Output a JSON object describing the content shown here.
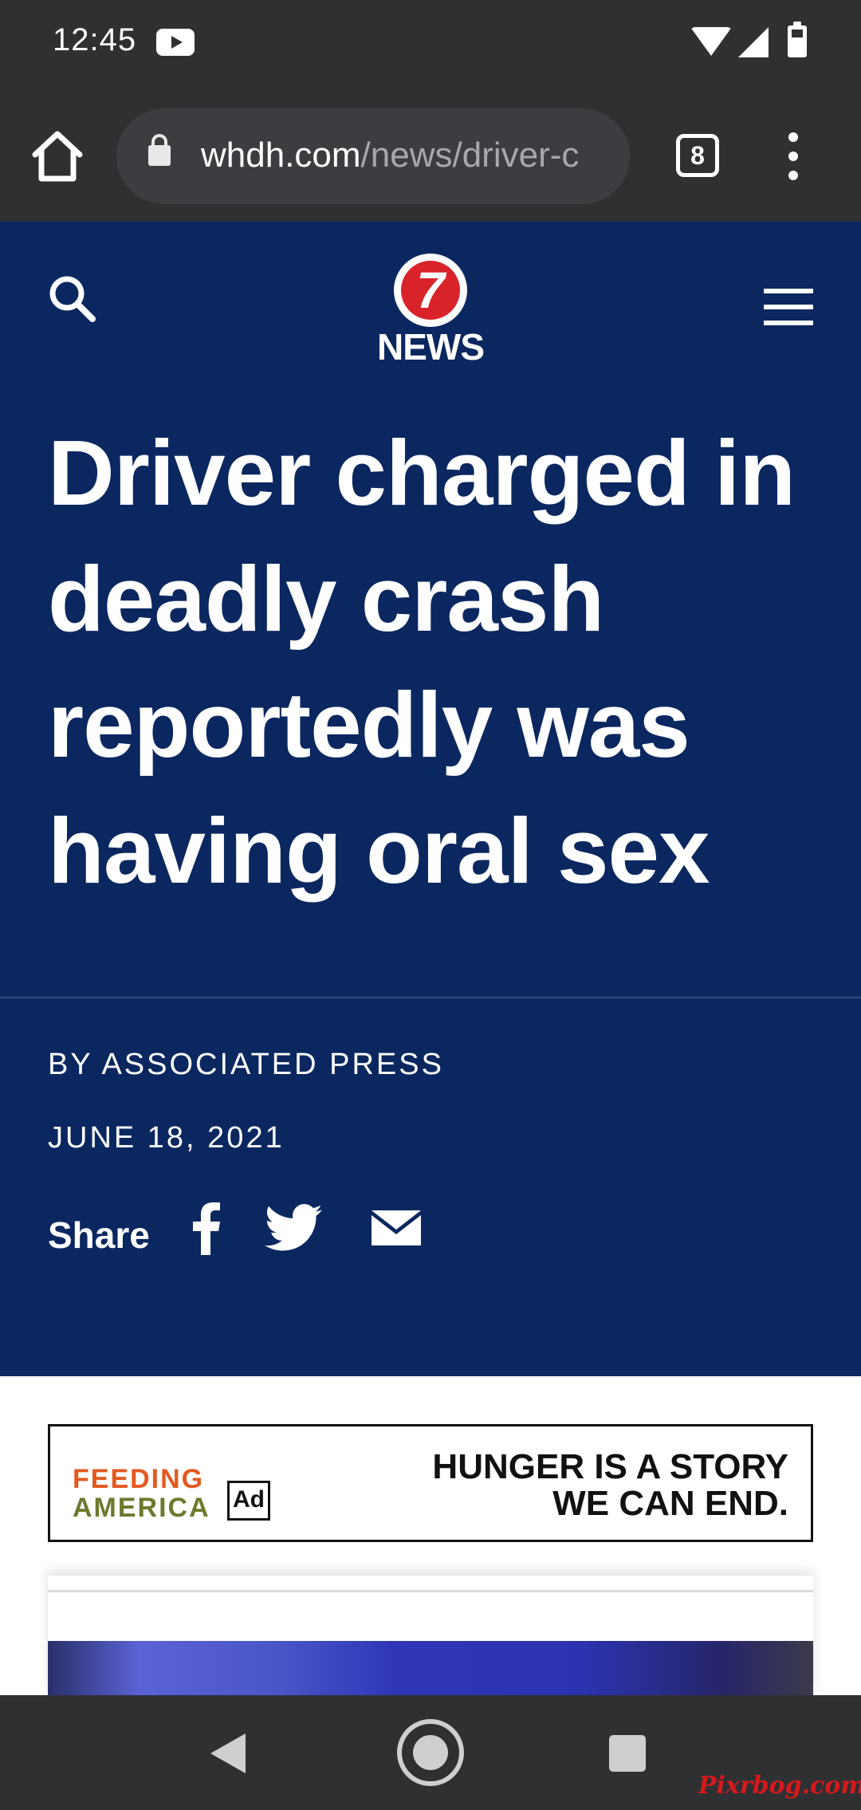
{
  "status_bar": {
    "time": "12:45",
    "icons": [
      "youtube-icon",
      "wifi-icon",
      "signal-icon",
      "battery-icon"
    ]
  },
  "browser": {
    "url_domain": "whdh.com",
    "url_path": "/news/driver-c",
    "tab_count": "8",
    "icons": [
      "home-icon",
      "lock-icon",
      "tabs-icon",
      "overflow-menu-icon"
    ]
  },
  "site": {
    "logo_number": "7",
    "logo_text": "NEWS",
    "icons": [
      "search-icon",
      "hamburger-menu-icon"
    ],
    "header_color": "#0b2760",
    "logo_red": "#d8232a"
  },
  "article": {
    "headline": "Driver charged in deadly crash reportedly was having oral sex",
    "byline": "BY ASSOCIATED PRESS",
    "date": "JUNE 18, 2021",
    "share_label": "Share",
    "share_icons": [
      "facebook-icon",
      "twitter-icon",
      "email-icon"
    ]
  },
  "ad": {
    "brand_line1": "FEEDING",
    "brand_line2": "AMERICA",
    "council_label": "Ad",
    "tagline_line1": "HUNGER IS A STORY",
    "tagline_line2": "WE CAN END."
  },
  "nav_bar": {
    "icons": [
      "back-icon",
      "home-icon",
      "recents-icon"
    ]
  },
  "watermark": "Pixrbog.com"
}
